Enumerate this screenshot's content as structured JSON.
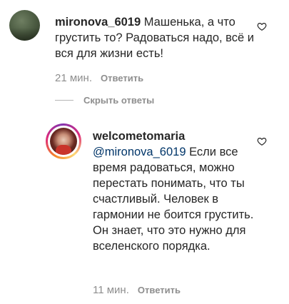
{
  "comments": [
    {
      "username": "mironova_6019",
      "text": "Машенька, а что грустить то? Радоваться надо, всё и вся для жизни есть!",
      "time": "21 мин.",
      "reply_label": "Ответить"
    }
  ],
  "toggle_replies_label": "Скрыть ответы",
  "replies": [
    {
      "username": "welcometomaria",
      "mention": "@mironova_6019",
      "text": "Если все время радоваться, можно перестать понимать, что ты счастливый. Человек в гармонии не боится грустить. Он знает, что это нужно для вселенского порядка.",
      "time": "11 мин.",
      "reply_label": "Ответить"
    }
  ],
  "icons": {
    "like": "heart-outline-icon"
  },
  "colors": {
    "text": "#262626",
    "muted": "#8e8e8e",
    "mention": "#003569"
  }
}
